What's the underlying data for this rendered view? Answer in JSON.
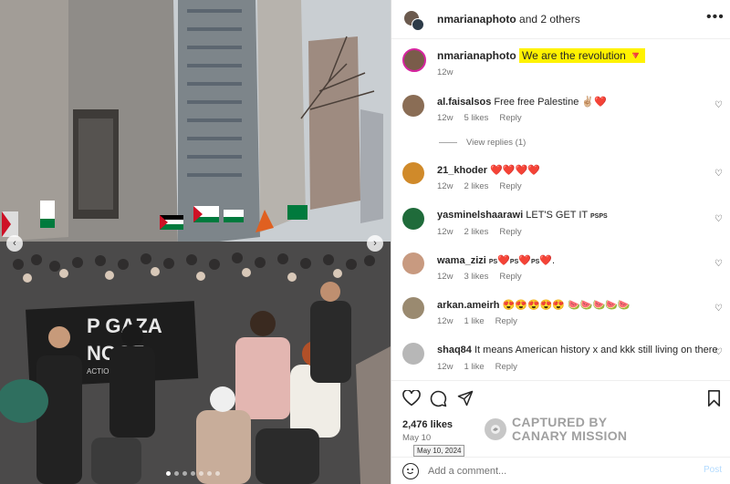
{
  "header": {
    "owner": "nmarianaphoto",
    "others_text": "and 2 others"
  },
  "caption": {
    "username": "nmarianaphoto",
    "text": "We are the revolution",
    "emoji": "🔻",
    "age": "12w"
  },
  "comments": [
    {
      "username": "al.faisalsos",
      "text": "Free free Palestine ✌🏼❤️",
      "age": "12w",
      "likes": "5 likes",
      "reply": "Reply"
    },
    {
      "username": "21_khoder",
      "text": "❤️❤️❤️❤️",
      "age": "12w",
      "likes": "2 likes",
      "reply": "Reply"
    },
    {
      "username": "yasminelshaarawi",
      "text": "LET'S GET IT",
      "small": "PSPS",
      "age": "12w",
      "likes": "2 likes",
      "reply": "Reply"
    },
    {
      "username": "wama_zizi",
      "text_parts": [
        "PS",
        "❤️",
        "PS",
        "❤️",
        "PS",
        "❤️",
        "."
      ],
      "age": "12w",
      "likes": "3 likes",
      "reply": "Reply"
    },
    {
      "username": "arkan.ameirh",
      "text": "😍😍😍😍😍 🍉🍉🍉🍉🍉",
      "age": "12w",
      "likes": "1 like",
      "reply": "Reply"
    },
    {
      "username": "shaq84",
      "text": "It means American history x and kkk still living on there",
      "age": "12w",
      "likes": "1 like",
      "reply": "Reply"
    }
  ],
  "view_replies": "View replies (1)",
  "actions": {
    "likes": "2,476 likes",
    "date": "May 10",
    "date_tooltip": "May 10, 2024"
  },
  "watermark": {
    "line1": "CAPTURED BY",
    "line2": "CANARY MISSION"
  },
  "composer": {
    "placeholder": "Add a comment...",
    "post_label": "Post"
  },
  "photo": {
    "banner_line1": "P GAZA",
    "banner_line2": "NOCE",
    "banner_line3": "ACTION FOR"
  },
  "icons": {
    "more": "more-options-icon",
    "heart": "heart-icon",
    "comment": "comment-icon",
    "share": "share-icon",
    "save": "bookmark-icon",
    "emoji": "emoji-icon"
  }
}
